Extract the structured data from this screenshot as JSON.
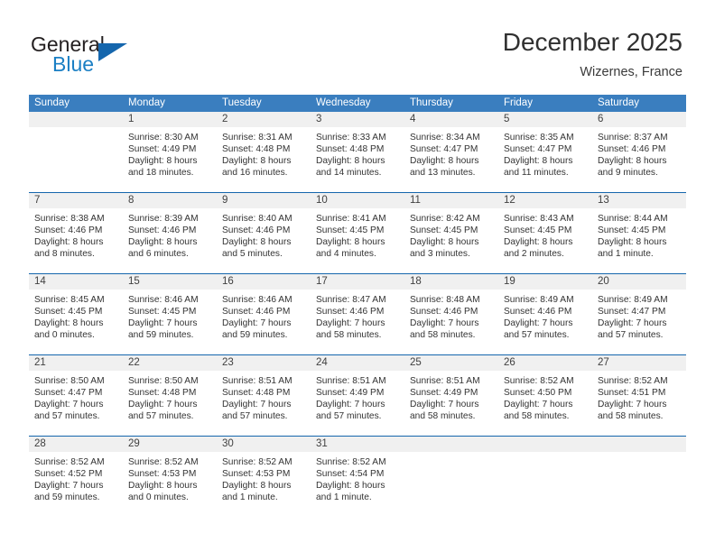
{
  "brand": {
    "name_top": "General",
    "name_bottom": "Blue",
    "triangle_color": "#1566ad",
    "blue_text_color": "#1b7fc4"
  },
  "header": {
    "title": "December 2025",
    "subtitle": "Wizernes, France"
  },
  "colors": {
    "header_row_bg": "#3a7ebf",
    "daynum_band_bg": "#f0f0f0",
    "row_divider": "#1566ad",
    "text": "#333333"
  },
  "weekdays": [
    "Sunday",
    "Monday",
    "Tuesday",
    "Wednesday",
    "Thursday",
    "Friday",
    "Saturday"
  ],
  "weeks": [
    [
      {
        "day": "",
        "sunrise": "",
        "sunset": "",
        "daylight1": "",
        "daylight2": ""
      },
      {
        "day": "1",
        "sunrise": "Sunrise: 8:30 AM",
        "sunset": "Sunset: 4:49 PM",
        "daylight1": "Daylight: 8 hours",
        "daylight2": "and 18 minutes."
      },
      {
        "day": "2",
        "sunrise": "Sunrise: 8:31 AM",
        "sunset": "Sunset: 4:48 PM",
        "daylight1": "Daylight: 8 hours",
        "daylight2": "and 16 minutes."
      },
      {
        "day": "3",
        "sunrise": "Sunrise: 8:33 AM",
        "sunset": "Sunset: 4:48 PM",
        "daylight1": "Daylight: 8 hours",
        "daylight2": "and 14 minutes."
      },
      {
        "day": "4",
        "sunrise": "Sunrise: 8:34 AM",
        "sunset": "Sunset: 4:47 PM",
        "daylight1": "Daylight: 8 hours",
        "daylight2": "and 13 minutes."
      },
      {
        "day": "5",
        "sunrise": "Sunrise: 8:35 AM",
        "sunset": "Sunset: 4:47 PM",
        "daylight1": "Daylight: 8 hours",
        "daylight2": "and 11 minutes."
      },
      {
        "day": "6",
        "sunrise": "Sunrise: 8:37 AM",
        "sunset": "Sunset: 4:46 PM",
        "daylight1": "Daylight: 8 hours",
        "daylight2": "and 9 minutes."
      }
    ],
    [
      {
        "day": "7",
        "sunrise": "Sunrise: 8:38 AM",
        "sunset": "Sunset: 4:46 PM",
        "daylight1": "Daylight: 8 hours",
        "daylight2": "and 8 minutes."
      },
      {
        "day": "8",
        "sunrise": "Sunrise: 8:39 AM",
        "sunset": "Sunset: 4:46 PM",
        "daylight1": "Daylight: 8 hours",
        "daylight2": "and 6 minutes."
      },
      {
        "day": "9",
        "sunrise": "Sunrise: 8:40 AM",
        "sunset": "Sunset: 4:46 PM",
        "daylight1": "Daylight: 8 hours",
        "daylight2": "and 5 minutes."
      },
      {
        "day": "10",
        "sunrise": "Sunrise: 8:41 AM",
        "sunset": "Sunset: 4:45 PM",
        "daylight1": "Daylight: 8 hours",
        "daylight2": "and 4 minutes."
      },
      {
        "day": "11",
        "sunrise": "Sunrise: 8:42 AM",
        "sunset": "Sunset: 4:45 PM",
        "daylight1": "Daylight: 8 hours",
        "daylight2": "and 3 minutes."
      },
      {
        "day": "12",
        "sunrise": "Sunrise: 8:43 AM",
        "sunset": "Sunset: 4:45 PM",
        "daylight1": "Daylight: 8 hours",
        "daylight2": "and 2 minutes."
      },
      {
        "day": "13",
        "sunrise": "Sunrise: 8:44 AM",
        "sunset": "Sunset: 4:45 PM",
        "daylight1": "Daylight: 8 hours",
        "daylight2": "and 1 minute."
      }
    ],
    [
      {
        "day": "14",
        "sunrise": "Sunrise: 8:45 AM",
        "sunset": "Sunset: 4:45 PM",
        "daylight1": "Daylight: 8 hours",
        "daylight2": "and 0 minutes."
      },
      {
        "day": "15",
        "sunrise": "Sunrise: 8:46 AM",
        "sunset": "Sunset: 4:45 PM",
        "daylight1": "Daylight: 7 hours",
        "daylight2": "and 59 minutes."
      },
      {
        "day": "16",
        "sunrise": "Sunrise: 8:46 AM",
        "sunset": "Sunset: 4:46 PM",
        "daylight1": "Daylight: 7 hours",
        "daylight2": "and 59 minutes."
      },
      {
        "day": "17",
        "sunrise": "Sunrise: 8:47 AM",
        "sunset": "Sunset: 4:46 PM",
        "daylight1": "Daylight: 7 hours",
        "daylight2": "and 58 minutes."
      },
      {
        "day": "18",
        "sunrise": "Sunrise: 8:48 AM",
        "sunset": "Sunset: 4:46 PM",
        "daylight1": "Daylight: 7 hours",
        "daylight2": "and 58 minutes."
      },
      {
        "day": "19",
        "sunrise": "Sunrise: 8:49 AM",
        "sunset": "Sunset: 4:46 PM",
        "daylight1": "Daylight: 7 hours",
        "daylight2": "and 57 minutes."
      },
      {
        "day": "20",
        "sunrise": "Sunrise: 8:49 AM",
        "sunset": "Sunset: 4:47 PM",
        "daylight1": "Daylight: 7 hours",
        "daylight2": "and 57 minutes."
      }
    ],
    [
      {
        "day": "21",
        "sunrise": "Sunrise: 8:50 AM",
        "sunset": "Sunset: 4:47 PM",
        "daylight1": "Daylight: 7 hours",
        "daylight2": "and 57 minutes."
      },
      {
        "day": "22",
        "sunrise": "Sunrise: 8:50 AM",
        "sunset": "Sunset: 4:48 PM",
        "daylight1": "Daylight: 7 hours",
        "daylight2": "and 57 minutes."
      },
      {
        "day": "23",
        "sunrise": "Sunrise: 8:51 AM",
        "sunset": "Sunset: 4:48 PM",
        "daylight1": "Daylight: 7 hours",
        "daylight2": "and 57 minutes."
      },
      {
        "day": "24",
        "sunrise": "Sunrise: 8:51 AM",
        "sunset": "Sunset: 4:49 PM",
        "daylight1": "Daylight: 7 hours",
        "daylight2": "and 57 minutes."
      },
      {
        "day": "25",
        "sunrise": "Sunrise: 8:51 AM",
        "sunset": "Sunset: 4:49 PM",
        "daylight1": "Daylight: 7 hours",
        "daylight2": "and 58 minutes."
      },
      {
        "day": "26",
        "sunrise": "Sunrise: 8:52 AM",
        "sunset": "Sunset: 4:50 PM",
        "daylight1": "Daylight: 7 hours",
        "daylight2": "and 58 minutes."
      },
      {
        "day": "27",
        "sunrise": "Sunrise: 8:52 AM",
        "sunset": "Sunset: 4:51 PM",
        "daylight1": "Daylight: 7 hours",
        "daylight2": "and 58 minutes."
      }
    ],
    [
      {
        "day": "28",
        "sunrise": "Sunrise: 8:52 AM",
        "sunset": "Sunset: 4:52 PM",
        "daylight1": "Daylight: 7 hours",
        "daylight2": "and 59 minutes."
      },
      {
        "day": "29",
        "sunrise": "Sunrise: 8:52 AM",
        "sunset": "Sunset: 4:53 PM",
        "daylight1": "Daylight: 8 hours",
        "daylight2": "and 0 minutes."
      },
      {
        "day": "30",
        "sunrise": "Sunrise: 8:52 AM",
        "sunset": "Sunset: 4:53 PM",
        "daylight1": "Daylight: 8 hours",
        "daylight2": "and 1 minute."
      },
      {
        "day": "31",
        "sunrise": "Sunrise: 8:52 AM",
        "sunset": "Sunset: 4:54 PM",
        "daylight1": "Daylight: 8 hours",
        "daylight2": "and 1 minute."
      },
      {
        "day": "",
        "sunrise": "",
        "sunset": "",
        "daylight1": "",
        "daylight2": ""
      },
      {
        "day": "",
        "sunrise": "",
        "sunset": "",
        "daylight1": "",
        "daylight2": ""
      },
      {
        "day": "",
        "sunrise": "",
        "sunset": "",
        "daylight1": "",
        "daylight2": ""
      }
    ]
  ]
}
